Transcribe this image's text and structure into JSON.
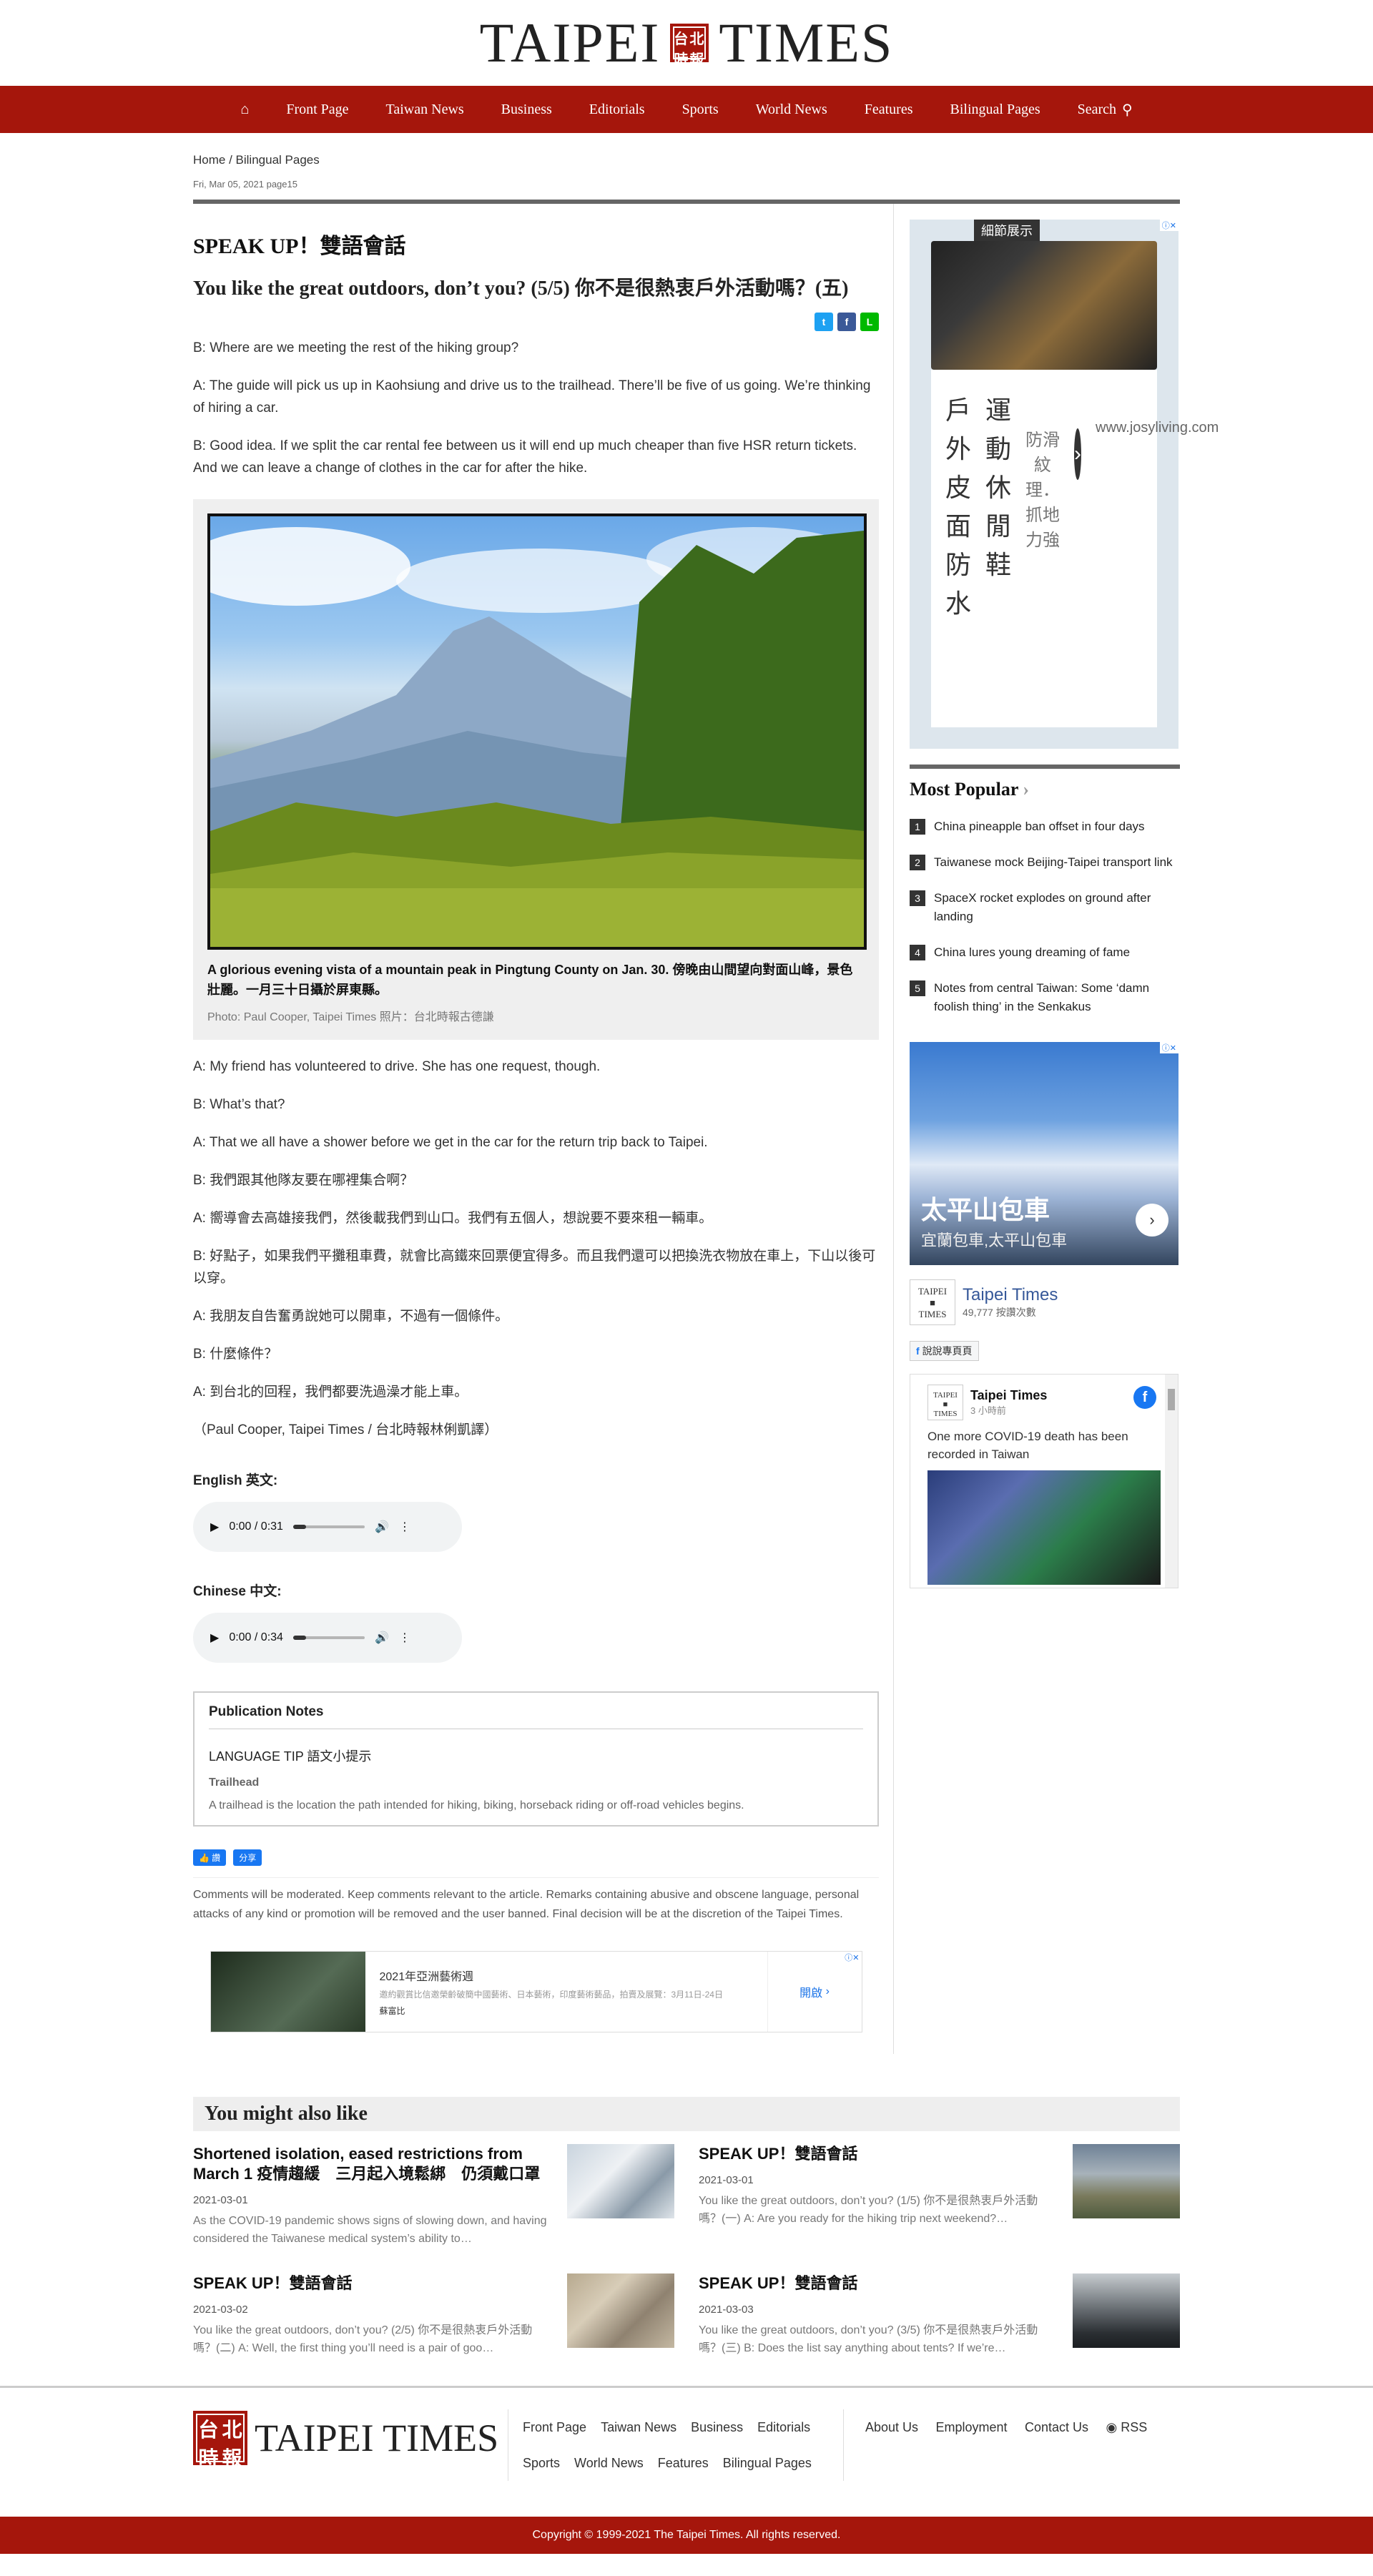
{
  "brand": {
    "title": "TAIPEI TIMES",
    "seal": [
      "台",
      "北",
      "時",
      "報"
    ]
  },
  "nav": {
    "items": [
      "Front Page",
      "Taiwan News",
      "Business",
      "Editorials",
      "Sports",
      "World News",
      "Features",
      "Bilingual Pages",
      "Search"
    ]
  },
  "breadcrumb": {
    "home": "Home",
    "sep": " / ",
    "section": "Bilingual Pages"
  },
  "dateline": "Fri, Mar 05, 2021 page15",
  "article": {
    "kicker": "SPEAK UP！雙語會話",
    "headline": "You like the great outdoors, don’t you? (5/5) 你不是很熱衷戶外活動嗎？(五)",
    "paras_top": [
      "B: Where are we meeting the rest of the hiking group?",
      "A: The guide will pick us up in Kaohsiung and drive us to the trailhead. There’ll be five of us going. We’re thinking of hiring a car.",
      "B: Good idea. If we split the car rental fee between us it will end up much cheaper than five HSR return tickets. And we can leave a change of clothes in the car for after the hike."
    ],
    "caption": "A glorious evening vista of a mountain peak in Pingtung County on Jan. 30. 傍晚由山間望向對面山峰，景色壯麗。一月三十日攝於屏東縣。",
    "credit": "Photo: Paul Cooper, Taipei Times 照片：台北時報古德謙",
    "paras_bottom": [
      "A: My friend has volunteered to drive. She has one request, though.",
      "B: What’s that?",
      "A: That we all have a shower before we get in the car for the return trip back to Taipei.",
      "B: 我們跟其他隊友要在哪裡集合啊？",
      "A: 嚮導會去高雄接我們，然後載我們到山口。我們有五個人，想說要不要來租一輛車。",
      "B: 好點子，如果我們平攤租車費，就會比高鐵來回票便宜得多。而且我們還可以把換洗衣物放在車上，下山以後可以穿。",
      "A: 我朋友自告奮勇說她可以開車，不過有一個條件。",
      "B: 什麼條件？",
      "A: 到台北的回程，我們都要洗過澡才能上車。",
      "（Paul Cooper, Taipei Times / 台北時報林俐凱譯）"
    ],
    "audio": [
      {
        "label": "English 英文:",
        "time": "0:00 / 0:31"
      },
      {
        "label": "Chinese 中文:",
        "time": "0:00 / 0:34"
      }
    ],
    "notes": {
      "title": "Publication Notes",
      "tip": "LANGUAGE TIP 語文小提示",
      "term": "Trailhead",
      "definition": "A trailhead is the location the path intended for hiking, biking, horseback riding or off-road vehicles begins."
    },
    "fb_like": "讚",
    "fb_share": "分享",
    "comments_note": "Comments will be moderated. Keep comments relevant to the article. Remarks containing abusive and obscene language, personal attacks of any kind or promotion will be removed and the user banned. Final decision will be at the discretion of the Taipei Times."
  },
  "ad_wide": {
    "title": "2021年亞洲藝術週",
    "sub": "邀約觀賞比信邀榮齡破簡中國藝術、日本藝術，印度藝術藝品，拍賣及展覽：3月11日-24日",
    "source": "蘇富比",
    "open": "開啟"
  },
  "ad_tall": {
    "banner": "細節展示",
    "headline_1": "戶外皮面防水",
    "headline_2": "運動休閒鞋",
    "sub": "防滑紋理．抓地力強",
    "url": "www.josyliving.com"
  },
  "most_popular": {
    "title": "Most Popular",
    "items": [
      "China pineapple ban offset in four days",
      "Taiwanese mock Beijing-Taipei transport link",
      "SpaceX rocket explodes on ground after landing",
      "China lures young dreaming of fame",
      "Notes from central Taiwan: Some ‘damn foolish thing’ in the Senkakus"
    ]
  },
  "ad_mountain": {
    "title": "太平山包車",
    "sub": "宜蘭包車,太平山包車"
  },
  "fb_page": {
    "name": "Taipei Times",
    "likes": "49,777 按讚次數",
    "share": "說說專頁頁",
    "post_name": "Taipei Times",
    "post_time": "3 小時前",
    "post_text": "One more COVID-19 death has been recorded in Taiwan"
  },
  "related": {
    "title": "You might also like",
    "items": [
      {
        "title": "Shortened isolation, eased restrictions from March 1 疫情趨緩　三月起入境鬆綁　仍須戴口罩",
        "date": "2021-03-01",
        "excerpt": "As the COVID-19 pandemic shows signs of slowing down, and having considered the Taiwanese medical system’s ability to…"
      },
      {
        "title": "SPEAK UP！雙語會話",
        "date": "2021-03-01",
        "excerpt": "You like the great outdoors, don’t you? (1/5) 你不是很熱衷戶外活動嗎？(一) A: Are you ready for the hiking trip next weekend?…"
      },
      {
        "title": "SPEAK UP！雙語會話",
        "date": "2021-03-02",
        "excerpt": "You like the great outdoors, don’t you? (2/5) 你不是很熱衷戶外活動嗎？(二) A: Well, the first thing you’ll need is a pair of goo…"
      },
      {
        "title": "SPEAK UP！雙語會話",
        "date": "2021-03-03",
        "excerpt": "You like the great outdoors, don’t you? (3/5) 你不是很熱衷戶外活動嗎？(三) B: Does the list say anything about tents? If we’re…"
      }
    ]
  },
  "footer": {
    "nav": [
      "Front Page",
      "Taiwan News",
      "Business",
      "Editorials",
      "Sports",
      "World News",
      "Features",
      "Bilingual Pages"
    ],
    "links": [
      "About Us",
      "Employment",
      "Contact Us",
      "RSS"
    ],
    "copyright": "Copyright © 1999-2021 The Taipei Times. All rights reserved."
  }
}
